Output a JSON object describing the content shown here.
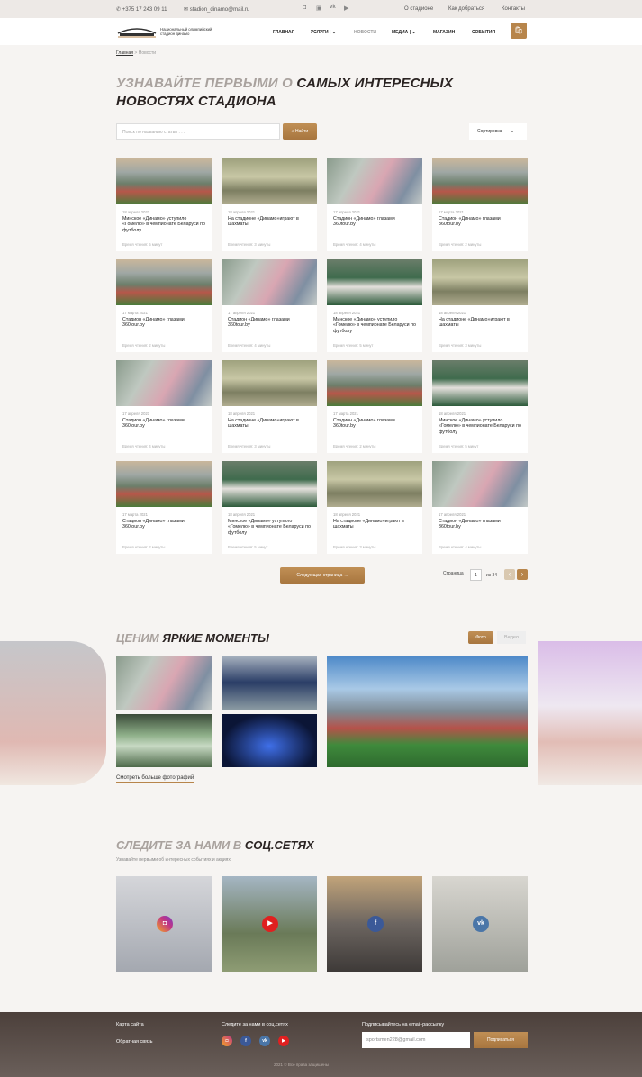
{
  "topbar": {
    "phone": "+375 17 243 09 11",
    "email": "stadion_dinamo@mail.ru",
    "links": [
      "О стадионе",
      "Как добраться",
      "Контакты"
    ]
  },
  "header": {
    "logo_text": "Национальный олимпийский стадион динамо",
    "nav": [
      "ГЛАВНАЯ",
      "УСЛУГИ",
      "НОВОСТИ",
      "МЕДИА",
      "МАГАЗИН",
      "СОБЫТИЯ"
    ]
  },
  "breadcrumb": {
    "home": "Главная",
    "sep": ">",
    "current": "Новости"
  },
  "hero": {
    "line1_grey": "УЗНАВАЙТЕ ПЕРВЫМИ О",
    "line1_dark": "САМЫХ ИНТЕРЕСНЫХ",
    "line2_dark": "НОВОСТЯХ СТАДИОНА"
  },
  "search": {
    "placeholder": "Поиск по названию статьи . . .",
    "button": "Найти"
  },
  "sort": {
    "label": "Сортировка"
  },
  "cards": [
    {
      "img": "stadium",
      "date": "18 апреля 2021",
      "title": "Минское «Динамо» уступило «Гомелю» в чемпионате Беларуси по футболу",
      "read": "Время чтения: 5 минут"
    },
    {
      "img": "chess",
      "date": "18 апреля 2021",
      "title": "На стадионе «Динамо»играют в шахматы",
      "read": "Время чтения: 3 минуты"
    },
    {
      "img": "fans",
      "date": "17 апреля 2021",
      "title": "Стадион «Динамо» глазами 360tour.by",
      "read": "Время чтения: 4 минуты"
    },
    {
      "img": "stadium",
      "date": "17 марта 2021",
      "title": "Стадион «Динамо» глазами 360tour.by",
      "read": "Время чтения: 2 минуты"
    },
    {
      "img": "stadium",
      "date": "17 марта 2021",
      "title": "Стадион «Динамо» глазами 360tour.by",
      "read": "Время чтения: 2 минуты"
    },
    {
      "img": "fans",
      "date": "17 апреля 2021",
      "title": "Стадион «Динамо» глазами 360tour.by",
      "read": "Время чтения: 4 минуты"
    },
    {
      "img": "players",
      "date": "18 апреля 2021",
      "title": "Минское «Динамо» уступило «Гомелю» в чемпионате Беларуси по футболу",
      "read": "Время чтения: 5 минут"
    },
    {
      "img": "chess",
      "date": "18 апреля 2021",
      "title": "На стадионе «Динамо»играют в шахматы",
      "read": "Время чтения: 3 минуты"
    },
    {
      "img": "fans",
      "date": "17 апреля 2021",
      "title": "Стадион «Динамо» глазами 360tour.by",
      "read": "Время чтения: 4 минуты"
    },
    {
      "img": "chess",
      "date": "18 апреля 2021",
      "title": "На стадионе «Динамо»играют в шахматы",
      "read": "Время чтения: 3 минуты"
    },
    {
      "img": "stadium",
      "date": "17 марта 2021",
      "title": "Стадион «Динамо» глазами 360tour.by",
      "read": "Время чтения: 2 минуты"
    },
    {
      "img": "players",
      "date": "18 апреля 2021",
      "title": "Минское «Динамо» уступило «Гомелю» в чемпионате Беларуси по футболу",
      "read": "Время чтения: 5 минут"
    },
    {
      "img": "stadium",
      "date": "17 марта 2021",
      "title": "Стадион «Динамо» глазами 360tour.by",
      "read": "Время чтения: 2 минуты"
    },
    {
      "img": "players",
      "date": "18 апреля 2021",
      "title": "Минское «Динамо» уступило «Гомелю» в чемпионате Беларуси по футболу",
      "read": "Время чтения: 5 минут"
    },
    {
      "img": "chess",
      "date": "18 апреля 2021",
      "title": "На стадионе «Динамо»играют в шахматы",
      "read": "Время чтения: 3 минуты"
    },
    {
      "img": "fans",
      "date": "17 апреля 2021",
      "title": "Стадион «Динамо» глазами 360tour.by",
      "read": "Время чтения: 4 минуты"
    }
  ],
  "pagination": {
    "next_button": "Следующая страница →",
    "label": "Страница",
    "current": "1",
    "of": "из 34"
  },
  "moments": {
    "title_grey": "ЦЕНИМ",
    "title_dark": "ЯРКИЕ МОМЕНТЫ",
    "tab_photo": "Фото",
    "tab_video": "Видео",
    "more": "Смотреть больше фотографий"
  },
  "social": {
    "title_grey": "СЛЕДИТЕ ЗА НАМИ В",
    "title_dark": "СОЦ.СЕТЯХ",
    "subtitle": "Узнавайте первыми об интересных событиях и акциях!"
  },
  "footer": {
    "sitemap": "Карта сайта",
    "feedback": "Обратная связь",
    "follow": "Следите за нами в соц.сетях",
    "subscribe_label": "Подписывайтесь на email-рассылку",
    "email_value": "sportsmen228@gmail.com",
    "subscribe_button": "Подписаться",
    "copyright": "2021 © Все права защищены"
  },
  "colors": {
    "accent": "#b7854b",
    "footer": "#4c403b"
  }
}
